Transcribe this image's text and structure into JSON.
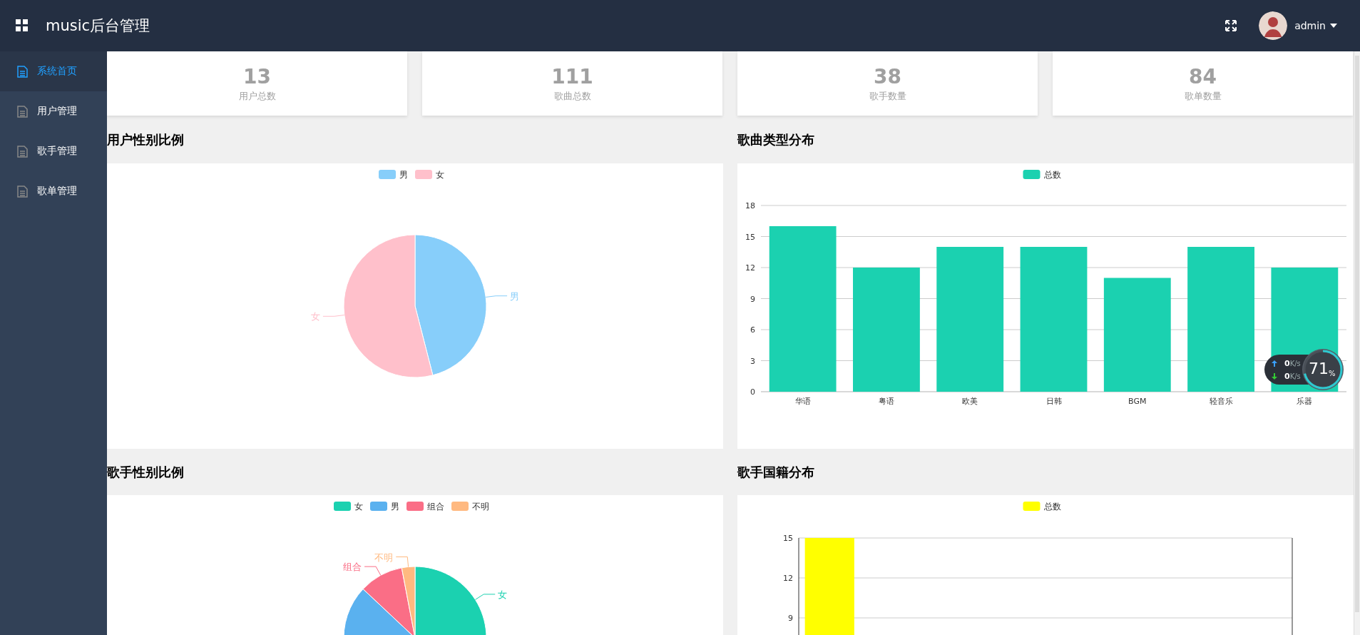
{
  "header": {
    "title": "music后台管理",
    "user": "admin"
  },
  "sidebar": {
    "items": [
      {
        "label": "系统首页",
        "selected": true
      },
      {
        "label": "用户管理",
        "selected": false
      },
      {
        "label": "歌手管理",
        "selected": false
      },
      {
        "label": "歌单管理",
        "selected": false
      }
    ]
  },
  "stats": [
    {
      "value": "13",
      "label": "用户总数"
    },
    {
      "value": "111",
      "label": "歌曲总数"
    },
    {
      "value": "38",
      "label": "歌手数量"
    },
    {
      "value": "84",
      "label": "歌单数量"
    }
  ],
  "charts": [
    {
      "title": "用户性别比例",
      "legend": [
        {
          "label": "男",
          "color": "#87cefa"
        },
        {
          "label": "女",
          "color": "#ffc0cb"
        }
      ],
      "chart_data": {
        "type": "pie",
        "categories": [
          "男",
          "女"
        ],
        "values": [
          46,
          54
        ]
      }
    },
    {
      "title": "歌曲类型分布",
      "chart_data": {
        "type": "bar",
        "categories": [
          "华语",
          "粤语",
          "欧美",
          "日韩",
          "BGM",
          "轻音乐",
          "乐器"
        ],
        "series": [
          {
            "name": "总数",
            "color": "#1bd1b0",
            "values": [
              16,
              12,
              14,
              14,
              11,
              14,
              12
            ]
          }
        ],
        "ylim": [
          0,
          18
        ],
        "yticks": [
          0,
          3,
          6,
          9,
          12,
          15,
          18
        ],
        "grid": true
      }
    },
    {
      "title": "歌手性别比例",
      "legend": [
        {
          "label": "女",
          "color": "#1bd1b0"
        },
        {
          "label": "男",
          "color": "#5ab1ef"
        },
        {
          "label": "组合",
          "color": "#fa6e86"
        },
        {
          "label": "不明",
          "color": "#ffb980"
        }
      ],
      "chart_data": {
        "type": "pie",
        "categories": [
          "女",
          null,
          "组合",
          "不明"
        ],
        "values": [
          32,
          55,
          10,
          3
        ]
      }
    },
    {
      "title": "歌手国籍分布",
      "chart_data": {
        "type": "bar",
        "series": [
          {
            "name": "总数",
            "color": "#ffff00",
            "values": [
              15
            ]
          }
        ],
        "ylim": [
          0,
          15
        ],
        "yticks": [
          9,
          12,
          15
        ],
        "grid": true
      }
    }
  ],
  "speed_widget": {
    "upload": "**0**K/s",
    "download": "**0**K/s",
    "percent": "71",
    "unit": "%"
  }
}
